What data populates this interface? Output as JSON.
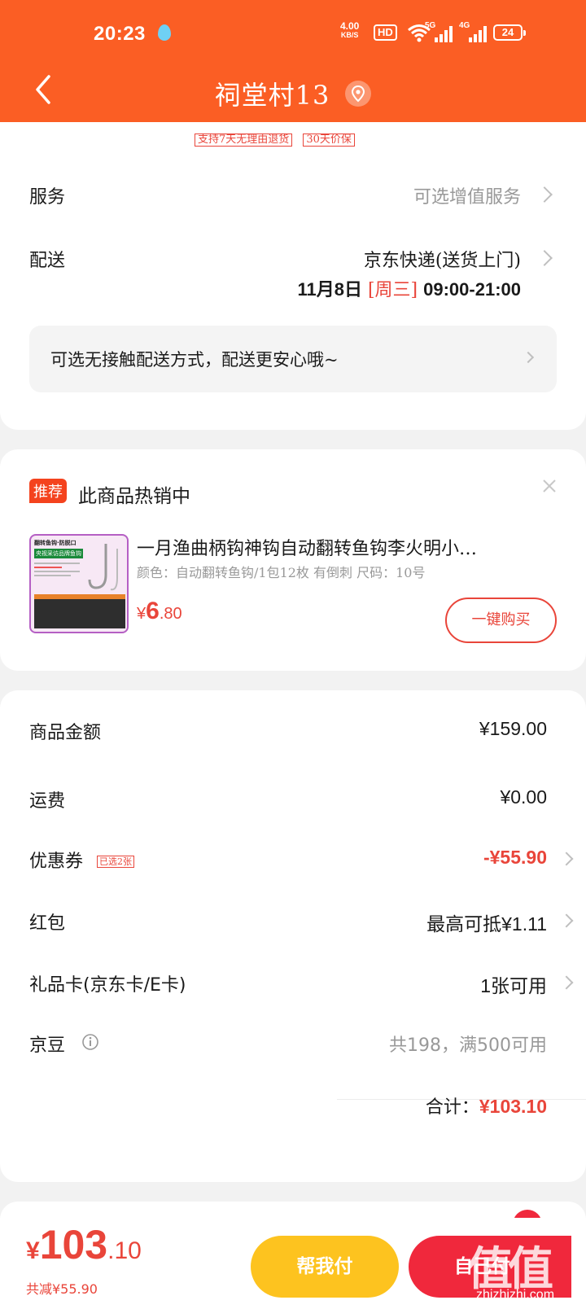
{
  "status_bar": {
    "time": "20:23",
    "net_speed_value": "4.00",
    "net_speed_unit": "KB/S",
    "hd_label": "HD",
    "sim1_label": "5G",
    "sim2_label": "4G",
    "battery": "24"
  },
  "header": {
    "title": "祠堂村13",
    "tags": [
      "支持7天无理由退货",
      "30天价保"
    ]
  },
  "order": {
    "service_label": "服务",
    "service_value": "可选增值服务",
    "delivery_label": "配送",
    "delivery_method": "京东快递(送货上门)",
    "delivery_date": "11月8日",
    "delivery_weekday": "[周三]",
    "delivery_time": "09:00-21:00",
    "contactless_notice": "可选无接触配送方式，配送更安心哦~"
  },
  "recommend": {
    "badge": "推荐",
    "title": "此商品热销中",
    "product_name": "一月渔曲柄钩神钩自动翻转鱼钩李火明小…",
    "product_spec": "颜色：自动翻转鱼钩/1包12枚 有倒刺   尺码：10号",
    "price_symbol": "¥",
    "price_int": "6",
    "price_dec": ".80",
    "buy_button": "一键购买",
    "image_texts": {
      "line1": "翻转鱼钩·防脱口",
      "line2": "央视采访品牌鱼钩"
    }
  },
  "summary": {
    "rows": [
      {
        "label": "商品金额",
        "value": "¥159.00"
      },
      {
        "label": "运费",
        "value": "¥0.00"
      },
      {
        "label": "优惠券",
        "tag": "已选2张",
        "value": "-¥55.90"
      },
      {
        "label": "红包",
        "value": "最高可抵¥1.11"
      },
      {
        "label": "礼品卡(京东卡/E卡)",
        "value": "1张可用"
      },
      {
        "label": "京豆",
        "value": "共198，满500可用"
      }
    ],
    "total_label": "合计：",
    "total_value": "¥103.10"
  },
  "bottom": {
    "price_symbol": "¥",
    "price_int": "103",
    "price_dec": ".10",
    "saved": "共减¥55.90",
    "help_pay": "帮我付",
    "pay_label": "自己付",
    "watermark": "值值值",
    "watermark_url": "zhizhizhi.com"
  },
  "colors": {
    "header_bg": "#fb5e24",
    "accent_red": "#e9453a",
    "help_btn": "#fdc31f",
    "pay_btn": "#f0283c"
  }
}
